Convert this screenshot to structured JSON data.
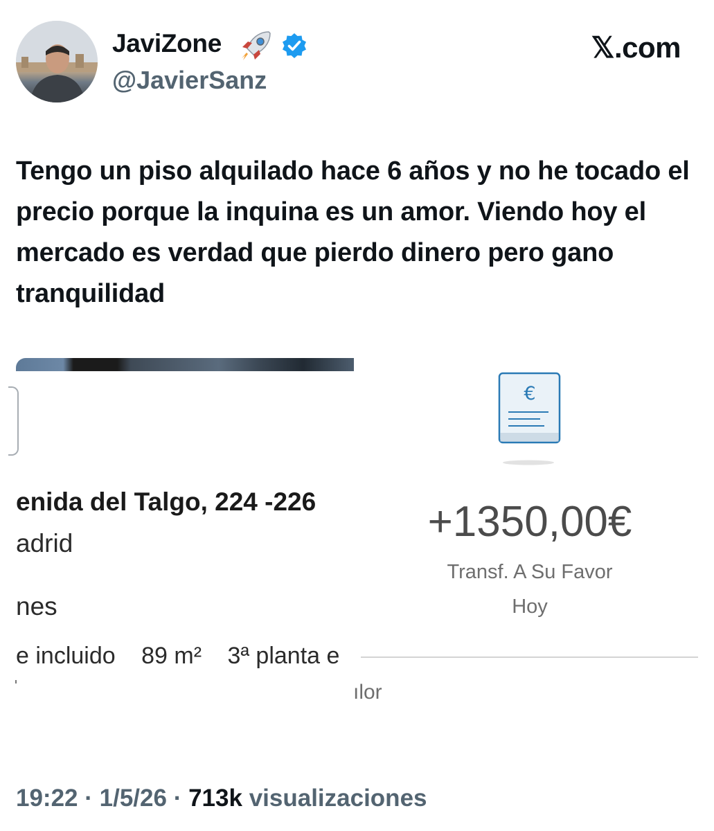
{
  "author": {
    "display_name": "JaviZone",
    "handle": "@JavierSanz",
    "verified_icon": "verified-badge-icon",
    "emoji_icon": "rocket-icon",
    "avatar": "profile-photo"
  },
  "site": {
    "label": "𝕏.com"
  },
  "tweet": {
    "text": "Tengo un piso alquilado hace 6 años y no he tocado el precio porque la inquina es un amor. Viendo hoy el mercado es verdad que pierdo dinero pero gano tranquilidad"
  },
  "listing": {
    "address": "enida del Talgo, 224 -226",
    "city": "adrid",
    "rooms": "nes",
    "features": [
      "e incluido",
      "89 m²",
      "3ª planta e"
    ]
  },
  "transfer": {
    "amount": "+1350,00€",
    "label": "Transf. A Su Favor",
    "date": "Hoy",
    "icon": "euro-receipt-icon",
    "icon_symbol": "€",
    "lower_fragment": "ılor"
  },
  "meta": {
    "time": "19:22",
    "separator": "·",
    "date": "1/5/26",
    "views_count": "713k",
    "views_label": "visualizaciones"
  },
  "colors": {
    "text": "#0f1419",
    "secondary": "#536471",
    "verified": "#1d9bf0",
    "receipt_blue": "#2a7ab5"
  }
}
